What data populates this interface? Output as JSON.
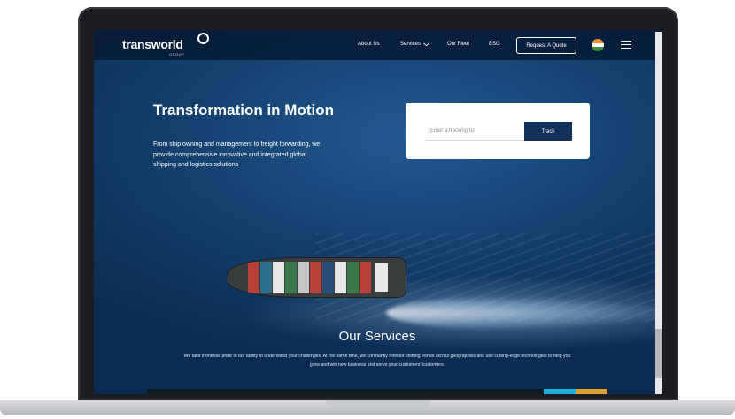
{
  "brand": {
    "name": "transworld",
    "sub": "GROUP"
  },
  "nav": {
    "items": [
      {
        "label": "About Us"
      },
      {
        "label": "Services"
      },
      {
        "label": "Our Fleet"
      },
      {
        "label": "ESG"
      }
    ],
    "quote_label": "Request A Quote"
  },
  "hero": {
    "title": "Transformation in Motion",
    "text": "From ship owning and management to freight forwarding, we provide comprehensive innovative and integrated global shipping and logistics solutions"
  },
  "tracking": {
    "placeholder": "Enter a tracking ID",
    "button_label": "Track"
  },
  "services": {
    "title": "Our Services",
    "text": "We take immense pride in our ability to understand your challenges. At the same time, we constantly monitor shifting trends across geographies and use cutting-edge technologies to help you grow and win new business and serve your customers' customers."
  },
  "colors": {
    "navy": "#12305a",
    "cyan": "#19b3dc",
    "orange": "#e1a12d"
  },
  "icons": [
    "logo-mark-icon",
    "chevron-down-icon",
    "india-flag-icon",
    "hamburger-menu-icon"
  ]
}
